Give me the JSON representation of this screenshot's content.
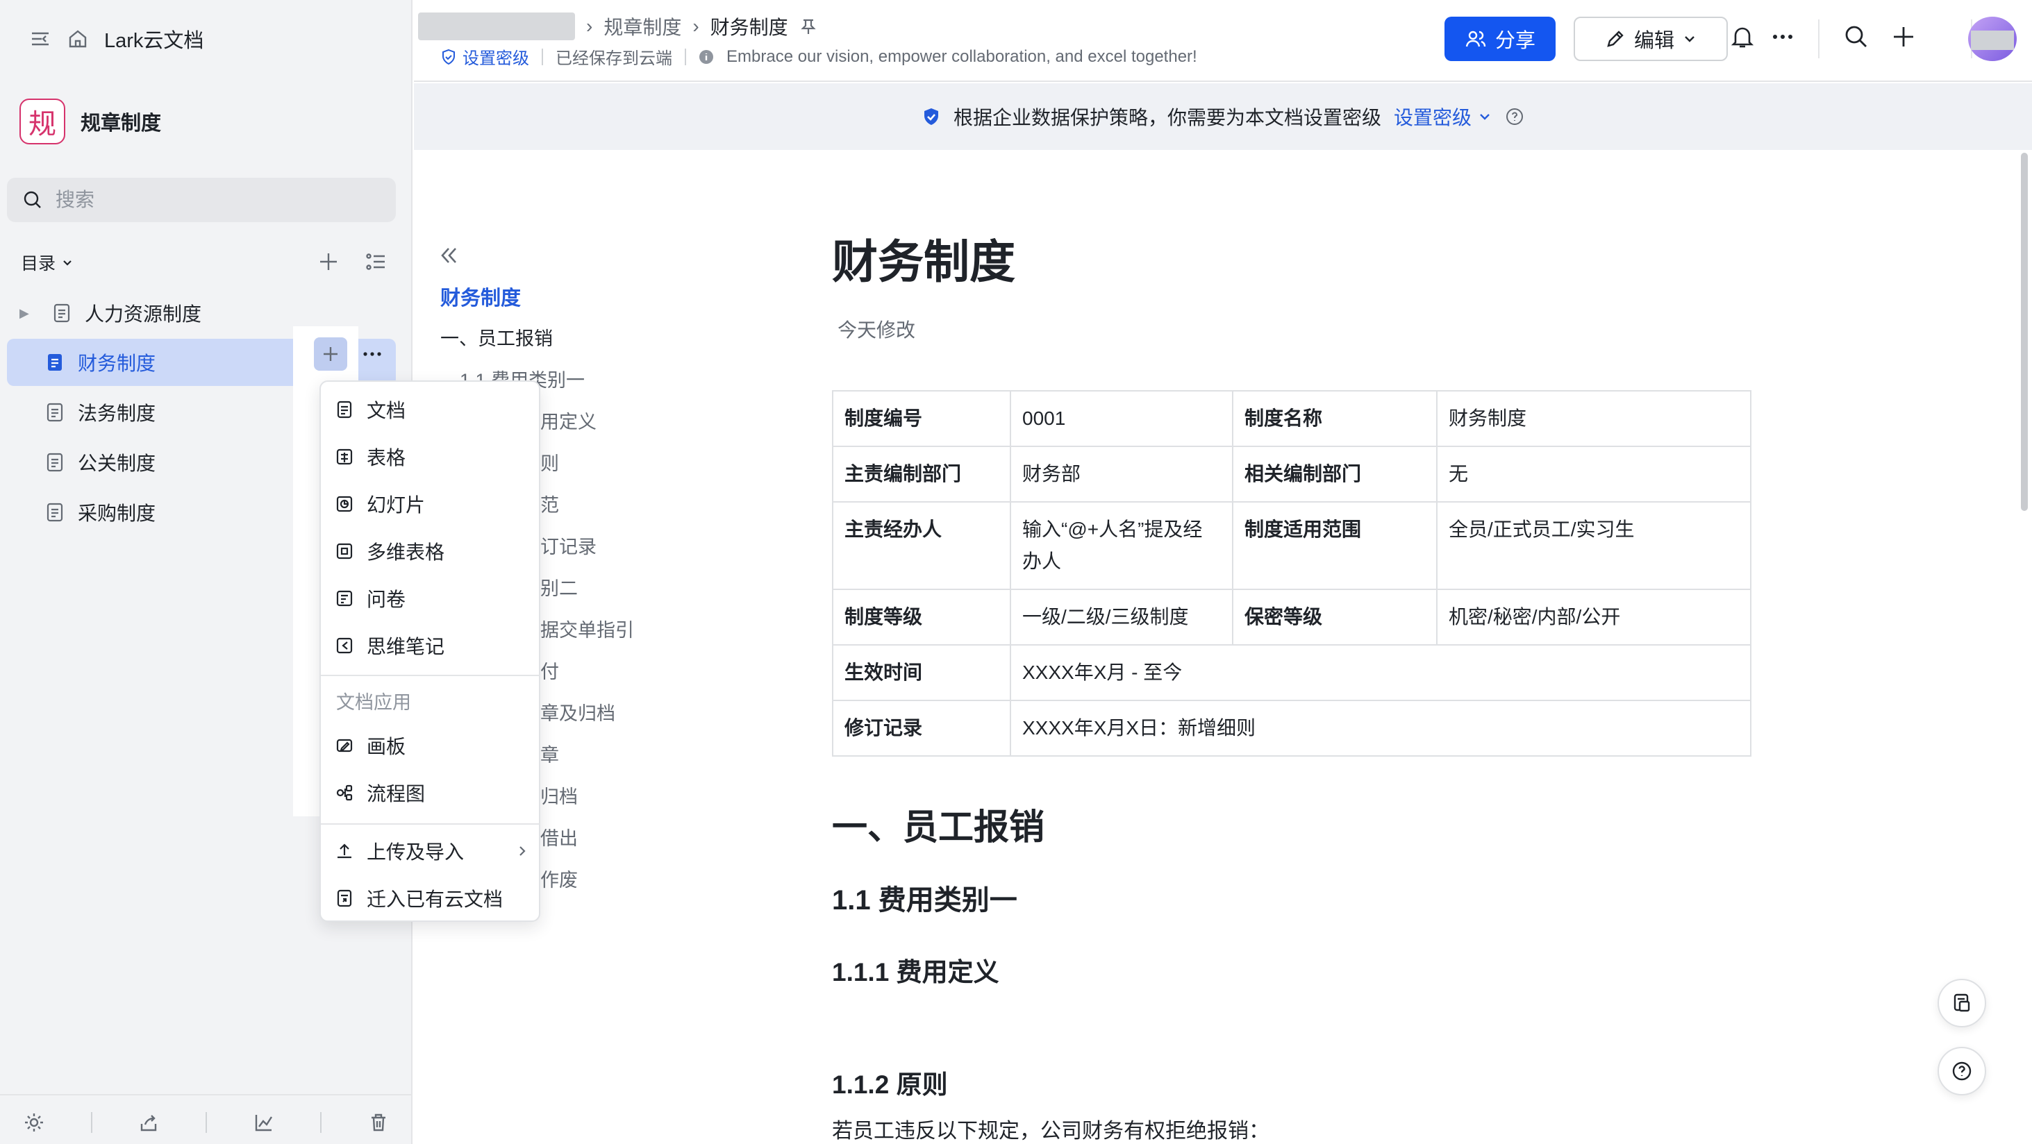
{
  "sidebar": {
    "brand": "Lark云文档",
    "space_logo": "规",
    "space_name": "规章制度",
    "search_placeholder": "搜索",
    "toc_label": "目录",
    "items": [
      {
        "label": "人力资源制度",
        "has_children": true
      },
      {
        "label": "财务制度",
        "active": true
      },
      {
        "label": "法务制度"
      },
      {
        "label": "公关制度"
      },
      {
        "label": "采购制度"
      }
    ]
  },
  "create_menu": {
    "items": [
      "文档",
      "表格",
      "幻灯片",
      "多维表格",
      "问卷",
      "思维笔记"
    ],
    "section_label": "文档应用",
    "app_items": [
      "画板",
      "流程图"
    ],
    "bottom_items": [
      "上传及导入",
      "迁入已有云文档"
    ]
  },
  "topbar": {
    "breadcrumb_parent": "规章制度",
    "breadcrumb_current": "财务制度",
    "security_level_label": "设置密级",
    "save_status": "已经保存到云端",
    "slogan": "Embrace our vision, empower collaboration, and excel together!",
    "share_label": "分享",
    "edit_label": "编辑"
  },
  "banner": {
    "text": "根据企业数据保护策略，你需要为本文档设置密级",
    "link": "设置密级"
  },
  "outline": [
    {
      "text": "财务制度"
    },
    {
      "text": "一、员工报销"
    },
    {
      "text": "1.1 费用类别一"
    },
    {
      "text": "用定义"
    },
    {
      "text": "则"
    },
    {
      "text": "范"
    },
    {
      "text": "订记录"
    },
    {
      "text": "别二"
    },
    {
      "text": "据交单指引"
    },
    {
      "text": "付"
    },
    {
      "text": "章及归档"
    },
    {
      "text": "章"
    },
    {
      "text": "归档"
    },
    {
      "text": "借出"
    },
    {
      "text": "作废"
    }
  ],
  "doc": {
    "title": "财务制度",
    "modified": "今天修改",
    "table": {
      "row1": {
        "k1": "制度编号",
        "v1": "0001",
        "k2": "制度名称",
        "v2": "财务制度"
      },
      "row2": {
        "k1": "主责编制部门",
        "v1": "财务部",
        "k2": "相关编制部门",
        "v2": "无"
      },
      "row3": {
        "k1": "主责经办人",
        "v1": "输入“@+人名”提及经办人",
        "k2": "制度适用范围",
        "v2": "全员/正式员工/实习生"
      },
      "row4": {
        "k1": "制度等级",
        "v1": "一级/二级/三级制度",
        "k2": "保密等级",
        "v2": "机密/秘密/内部/公开"
      },
      "row5": {
        "k1": "生效时间",
        "v1": "XXXX年X月 - 至今"
      },
      "row6": {
        "k1": "修订记录",
        "v1": "XXXX年X月X日：新增细则"
      }
    },
    "h1": "一、员工报销",
    "h2": "1.1 费用类别一",
    "h3a": "1.1.1 费用定义",
    "h3b": "1.1.2 原则",
    "para": "若员工违反以下规定，公司财务有权拒绝报销："
  },
  "colors": {
    "accent": "#1456f0",
    "active_bg": "#ccd9f8",
    "sidebar_bg": "#f2f3f5",
    "banner_bg": "#eff1f5"
  }
}
